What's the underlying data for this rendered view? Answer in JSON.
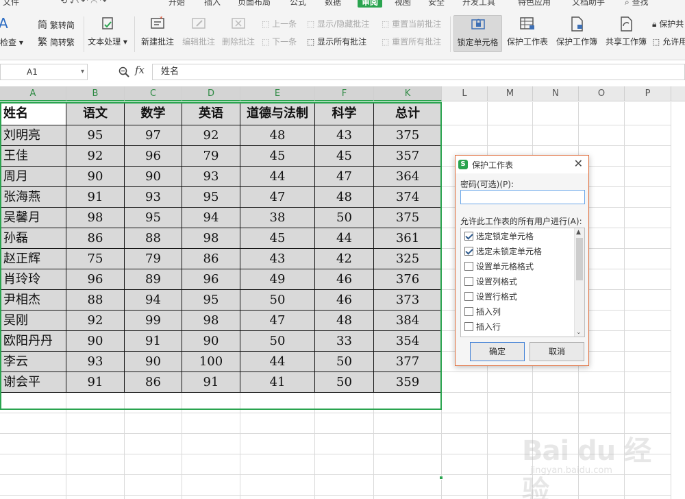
{
  "ribbon": {
    "tabs": [
      "文件",
      "开始",
      "插入",
      "页面布局",
      "公式",
      "数据",
      "审阅",
      "视图",
      "安全",
      "开发工具",
      "特色应用",
      "文档助手",
      "查找"
    ],
    "active_tab": "审阅",
    "spellcheck_label": "拼写检查",
    "trad_to_simp_label": "繁转简",
    "simp_to_trad_label": "简转繁",
    "text_processing_label": "文本处理",
    "new_comment_label": "新建批注",
    "edit_comment_label": "编辑批注",
    "delete_comment_label": "删除批注",
    "prev_label": "上一条",
    "next_label": "下一条",
    "show_hide_comment_label": "显示/隐藏批注",
    "show_all_comments_label": "显示所有批注",
    "reset_current_comment_label": "重置当前批注",
    "reset_all_comments_label": "重置所有批注",
    "lock_cell_label": "锁定单元格",
    "protect_sheet_label": "保护工作表",
    "protect_workbook_label": "保护工作簿",
    "share_workbook_label": "共享工作簿",
    "protect_share_label": "保护共",
    "allow_label": "允许用"
  },
  "formula_bar": {
    "cell_ref": "A1",
    "fx_label": "fx",
    "content": "姓名"
  },
  "grid": {
    "columns": [
      "A",
      "B",
      "C",
      "D",
      "E",
      "F",
      "K",
      "L",
      "M",
      "N",
      "O",
      "P"
    ],
    "header_row": [
      "姓名",
      "语文",
      "数学",
      "英语",
      "道德与法制",
      "科学",
      "总计"
    ],
    "rows": [
      [
        "刘明亮",
        "95",
        "97",
        "92",
        "48",
        "43",
        "375"
      ],
      [
        "王佳",
        "92",
        "96",
        "79",
        "45",
        "45",
        "357"
      ],
      [
        "周月",
        "90",
        "90",
        "93",
        "44",
        "47",
        "364"
      ],
      [
        "张海燕",
        "91",
        "93",
        "95",
        "47",
        "48",
        "374"
      ],
      [
        "吴馨月",
        "98",
        "95",
        "94",
        "38",
        "50",
        "375"
      ],
      [
        "孙磊",
        "86",
        "88",
        "98",
        "45",
        "44",
        "361"
      ],
      [
        "赵正辉",
        "75",
        "79",
        "86",
        "43",
        "42",
        "325"
      ],
      [
        "肖玲玲",
        "96",
        "89",
        "96",
        "49",
        "46",
        "376"
      ],
      [
        "尹相杰",
        "88",
        "94",
        "95",
        "50",
        "46",
        "373"
      ],
      [
        "吴刚",
        "92",
        "99",
        "98",
        "47",
        "48",
        "384"
      ],
      [
        "欧阳丹丹",
        "90",
        "91",
        "90",
        "50",
        "33",
        "354"
      ],
      [
        "李云",
        "93",
        "90",
        "100",
        "44",
        "50",
        "377"
      ],
      [
        "谢会平",
        "91",
        "86",
        "91",
        "41",
        "50",
        "359"
      ]
    ]
  },
  "dialog": {
    "title": "保护工作表",
    "password_label": "密码(可选)(P):",
    "password_value": "",
    "allow_label": "允许此工作表的所有用户进行(A):",
    "permissions": [
      {
        "label": "选定锁定单元格",
        "checked": true
      },
      {
        "label": "选定未锁定单元格",
        "checked": true
      },
      {
        "label": "设置单元格格式",
        "checked": false
      },
      {
        "label": "设置列格式",
        "checked": false
      },
      {
        "label": "设置行格式",
        "checked": false
      },
      {
        "label": "插入列",
        "checked": false
      },
      {
        "label": "插入行",
        "checked": false
      }
    ],
    "ok_label": "确定",
    "cancel_label": "取消"
  },
  "watermark": {
    "brand": "Bai du 经验",
    "url": "jingyan.baidu.com"
  }
}
